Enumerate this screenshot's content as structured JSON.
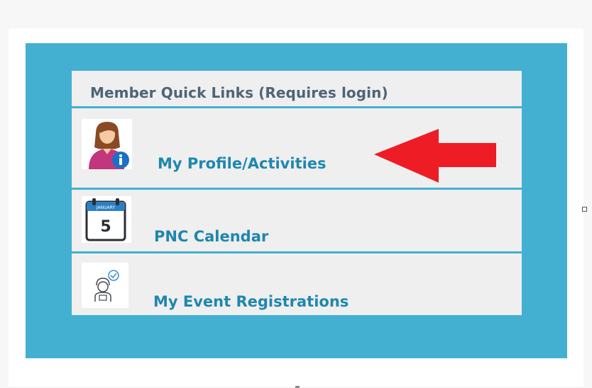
{
  "quick_links": {
    "header_title": "Member Quick Links (Requires login)",
    "items": [
      {
        "label": "My Profile/Activities",
        "icon": "user-profile-info-icon"
      },
      {
        "label": "PNC Calendar",
        "icon": "calendar-icon",
        "calendar_day": "5",
        "calendar_month": "JANUARY"
      },
      {
        "label": "My Event Registrations",
        "icon": "event-registration-person-icon"
      }
    ]
  },
  "colors": {
    "panel_teal": "#43b0d1",
    "link_blue": "#1f87ad",
    "header_text": "#4f6476",
    "arrow_red": "#ee1c25",
    "row_background": "#efefef"
  }
}
